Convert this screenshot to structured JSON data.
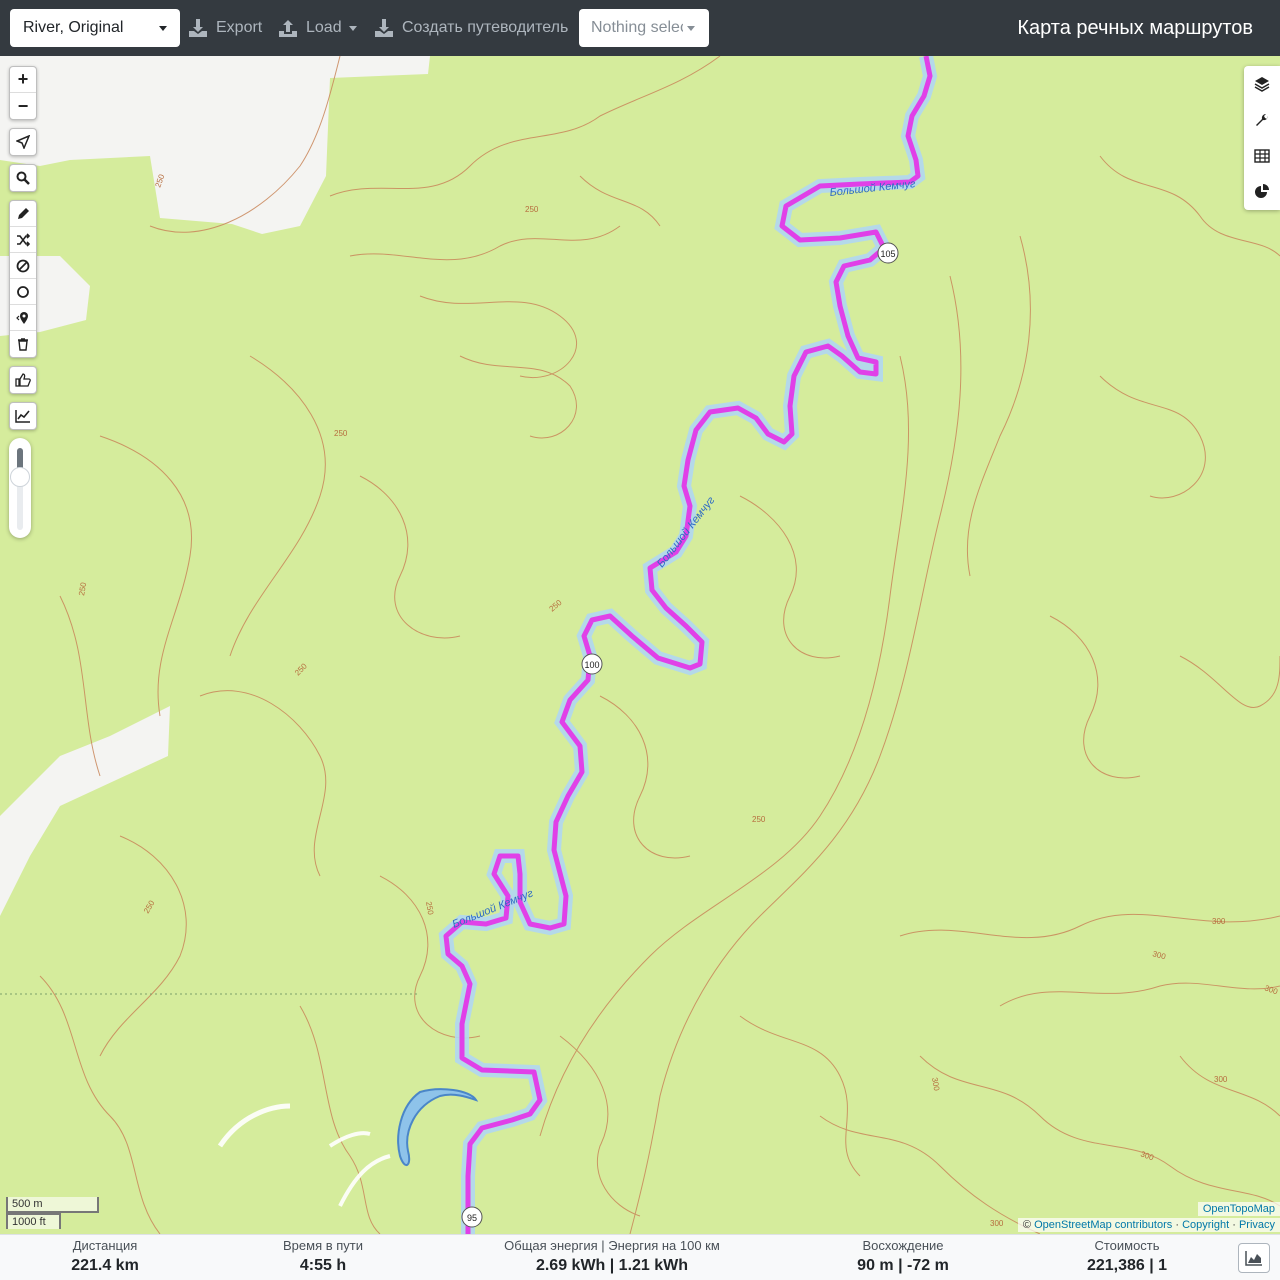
{
  "header": {
    "profile_select": "River, Original",
    "export_label": "Export",
    "load_label": "Load",
    "guide_label": "Создать путеводитель",
    "route_select_placeholder": "Nothing selected",
    "app_title": "Карта речных маршрутов"
  },
  "map": {
    "river_labels": [
      "Большой Кемчуг",
      "Большой Кемчуг",
      "Большой Кемчуг"
    ],
    "km_markers": [
      "105",
      "100",
      "95"
    ],
    "contour_labels": [
      "250",
      "250",
      "250",
      "250",
      "250",
      "250",
      "250",
      "250",
      "250",
      "300",
      "300",
      "300",
      "300",
      "300",
      "300",
      "300"
    ],
    "scale_metric": "500 m",
    "scale_imperial": "1000 ft",
    "attribution_otm": "OpenTopoMap",
    "attribution_prefix": "©",
    "attribution_osm": "OpenStreetMap contributors",
    "attribution_copyright": "Copyright",
    "attribution_privacy": "Privacy",
    "attribution_sep": "·",
    "route_color": "#e040e8",
    "river_color": "#5b8fd6",
    "terrain_color": "#d5ec9c",
    "contour_color": "#c9865a"
  },
  "controls": {
    "zoom_in": "+",
    "zoom_out": "−",
    "right_icons": [
      "layers-icon",
      "wrench-icon",
      "table-icon",
      "pie-chart-icon"
    ],
    "left_icons": [
      "locate-icon",
      "search-icon",
      "draw-icon",
      "shuffle-icon",
      "no-entry-icon",
      "circle-icon",
      "pin-icon",
      "trash-icon",
      "thumbs-up-icon",
      "chart-icon"
    ],
    "opacity_slider_level": 0.3
  },
  "stats": {
    "distance_label": "Дистанция",
    "distance_value": "221.4 km",
    "time_label": "Время в пути",
    "time_value": "4:55 h",
    "energy_label": "Общая энергия | Энергия на 100 км",
    "energy_value": "2.69 kWh | 1.21 kWh",
    "ascent_label": "Восхождение",
    "ascent_value": "90 m | -72 m",
    "cost_label": "Стоимость",
    "cost_value": "221,386 | 1"
  }
}
